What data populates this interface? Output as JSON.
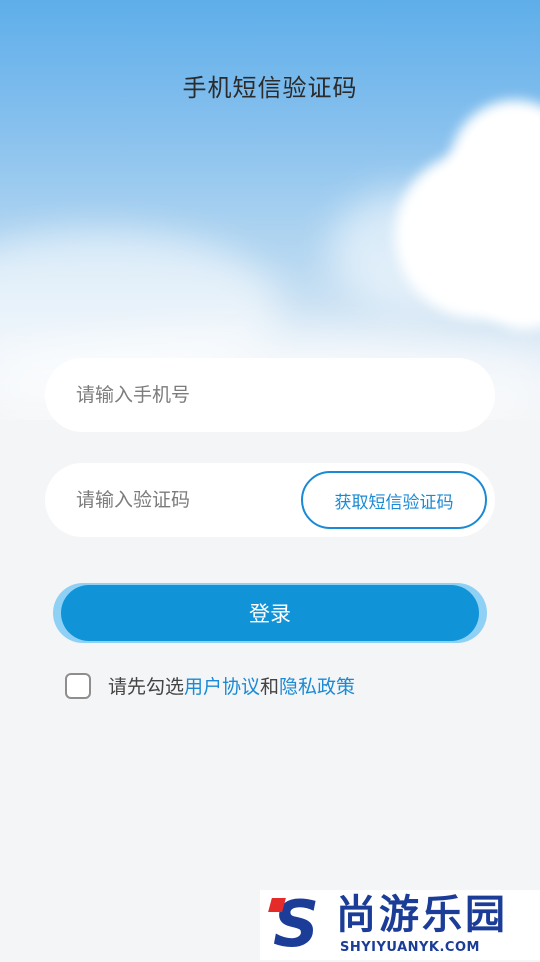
{
  "header": {
    "title": "手机短信验证码"
  },
  "form": {
    "phone": {
      "placeholder": "请输入手机号",
      "value": ""
    },
    "code": {
      "placeholder": "请输入验证码",
      "value": "",
      "get_code_label": "获取短信验证码"
    },
    "login_label": "登录"
  },
  "agreement": {
    "checked": false,
    "prefix": "请先勾选",
    "user_agreement": "用户协议",
    "conjunction": "和",
    "privacy_policy": "隐私政策"
  },
  "watermark": {
    "brand_cn": "尚游乐园",
    "brand_en": "SHYIYUANYK.COM"
  },
  "colors": {
    "accent": "#1a8ad4",
    "button": "#1193d8",
    "button_glow": "#8fd0f5"
  }
}
